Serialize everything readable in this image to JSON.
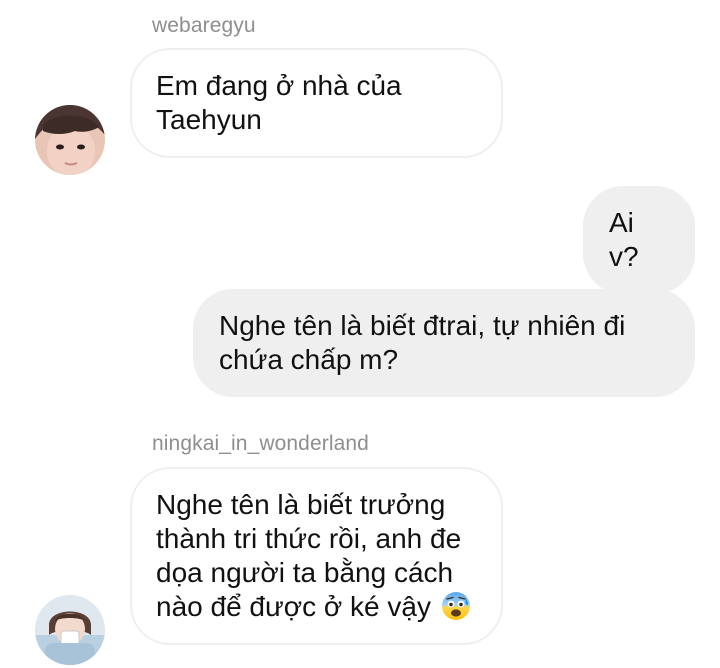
{
  "conversation": {
    "messages": [
      {
        "sender": "webaregyu",
        "direction": "received",
        "lines": [
          "Em đang ở nhà của",
          "Taehyun"
        ]
      },
      {
        "direction": "sent",
        "lines": [
          "Ai v?"
        ]
      },
      {
        "direction": "sent",
        "lines": [
          "Nghe tên là biết đtrai, tự nhiên đi",
          "chứa chấp m?"
        ]
      },
      {
        "sender": "ningkai_in_wonderland",
        "direction": "received",
        "lines": [
          "Nghe tên là biết trưởng",
          "thành tri thức rồi, anh đe",
          "dọa người ta bằng cách",
          "nào để được ở ké vậy"
        ],
        "trailing_icon": "anxious-face-with-sweat-emoji"
      }
    ]
  },
  "colors": {
    "received_bubble_bg": "#ffffff",
    "received_bubble_border": "#efefef",
    "sent_bubble_bg": "#efefef",
    "username_text": "#8e8e8e",
    "message_text": "#111111"
  }
}
